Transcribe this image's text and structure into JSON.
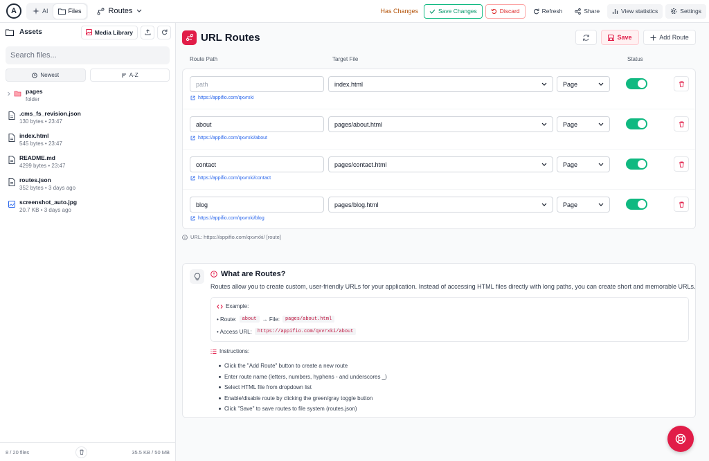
{
  "topbar": {
    "logo_letter": "A",
    "tabs": [
      {
        "label": "AI"
      },
      {
        "label": "Files"
      }
    ],
    "route_selector": "Routes",
    "has_changes": "Has Changes",
    "save_changes": "Save Changes",
    "discard": "Discard",
    "refresh": "Refresh",
    "share": "Share",
    "view_statistics": "View statistics",
    "settings": "Settings"
  },
  "sidebar": {
    "title": "Assets",
    "media_library": "Media Library",
    "search_placeholder": "Search files...",
    "sort": {
      "newest": "Newest",
      "az": "A-Z"
    },
    "files": [
      {
        "name": "pages",
        "meta": "folder",
        "icon": "folder-icon"
      },
      {
        "name": ".cms_fs_revision.json",
        "meta": "130 bytes • 23:47",
        "icon": "file-icon"
      },
      {
        "name": "index.html",
        "meta": "545 bytes • 23:47",
        "icon": "file-icon"
      },
      {
        "name": "README.md",
        "meta": "4299 bytes • 23:47",
        "icon": "file-icon"
      },
      {
        "name": "routes.json",
        "meta": "352 bytes • 3 days ago",
        "icon": "file-icon"
      },
      {
        "name": "screenshot_auto.jpg",
        "meta": "20.7 KB • 3 days ago",
        "icon": "image-icon"
      }
    ],
    "footer_count": "8 / 20 files",
    "footer_size": "35.5 KB / 50 MB"
  },
  "main": {
    "title": "URL Routes",
    "save": "Save",
    "add_route": "Add Route",
    "columns": {
      "path": "Route Path",
      "target": "Target File",
      "status": "Status"
    },
    "routes": [
      {
        "path": "",
        "placeholder": "path",
        "target": "index.html",
        "type": "Page",
        "url": "https://appifio.com/qxvrxki",
        "enabled": true
      },
      {
        "path": "about",
        "placeholder": "path",
        "target": "pages/about.html",
        "type": "Page",
        "url": "https://appifio.com/qxvrxki/about",
        "enabled": true
      },
      {
        "path": "contact",
        "placeholder": "path",
        "target": "pages/contact.html",
        "type": "Page",
        "url": "https://appifio.com/qxvrxki/contact",
        "enabled": true
      },
      {
        "path": "blog",
        "placeholder": "path",
        "target": "pages/blog.html",
        "type": "Page",
        "url": "https://appifio.com/qxvrxki/blog",
        "enabled": true
      }
    ],
    "url_note": "URL: https://appifio.com/qxvrxki/ [route]"
  },
  "help": {
    "title": "What are Routes?",
    "description": "Routes allow you to create custom, user-friendly URLs for your application. Instead of accessing HTML files directly with long paths, you can create short and memorable URLs.",
    "example_title": "Example:",
    "example_route_label": "• Route:",
    "example_route": "about",
    "example_file_label": "→ File:",
    "example_file": "pages/about.html",
    "example_access_label": "• Access URL:",
    "example_access": "https://appifio.com/qxvrxki/about",
    "instructions_title": "Instructions:",
    "instructions": [
      "Click the \"Add Route\" button to create a new route",
      "Enter route name (letters, numbers, hyphens - and underscores _)",
      "Select HTML file from dropdown list",
      "Enable/disable route by clicking the green/gray toggle button",
      "Click \"Save\" to save routes to file system (routes.json)"
    ]
  },
  "colors": {
    "accent": "#e11d48",
    "toggle_on": "#10b981",
    "link": "#2563eb"
  }
}
